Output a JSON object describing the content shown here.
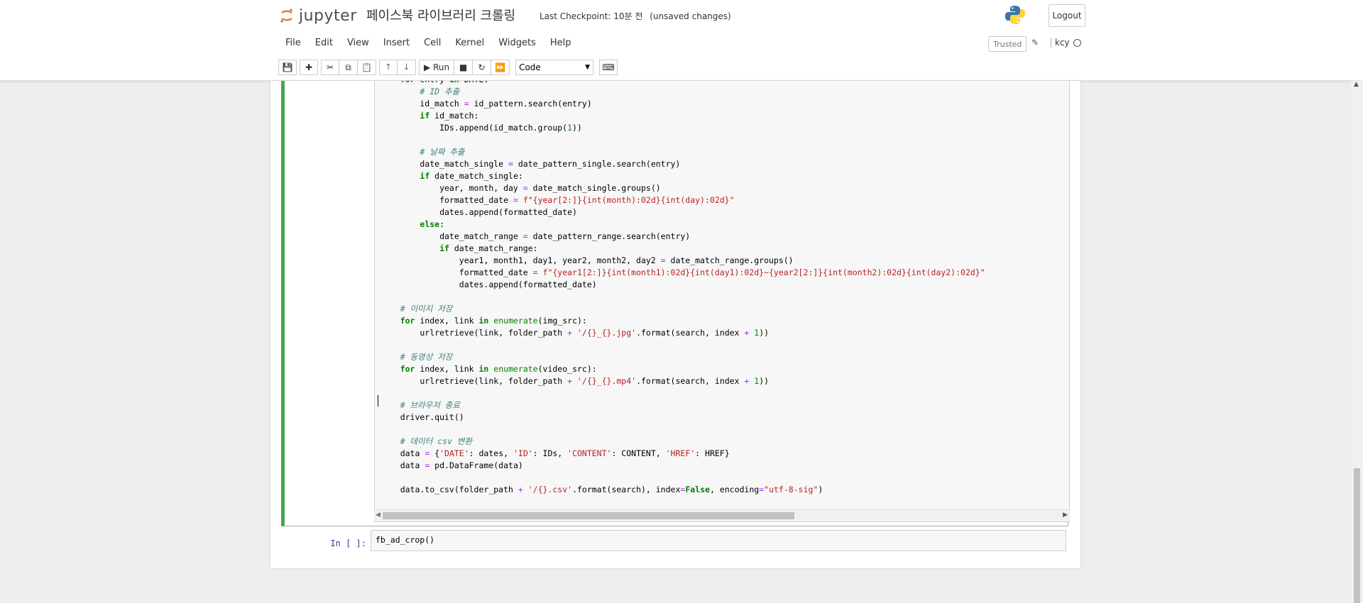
{
  "header": {
    "logo_text": "jupyter",
    "notebook_title": "페이스북 라이브러리 크롤링",
    "checkpoint_label": "Last Checkpoint:",
    "checkpoint_time": "10분 전",
    "save_status": "(unsaved changes)",
    "logout_label": "Logout"
  },
  "menu": {
    "items": [
      "File",
      "Edit",
      "View",
      "Insert",
      "Cell",
      "Kernel",
      "Widgets",
      "Help"
    ],
    "trusted_label": "Trusted",
    "kernel_name": "kcy"
  },
  "toolbar": {
    "run_label": "Run",
    "cell_type": "Code"
  },
  "cells": [
    {
      "prompt": "",
      "code_lines": [
        "    for entry in DATE:",
        "        # ID 추출",
        "        id_match = id_pattern.search(entry)",
        "        if id_match:",
        "            IDs.append(id_match.group(1))",
        "",
        "        # 날짜 추출",
        "        date_match_single = date_pattern_single.search(entry)",
        "        if date_match_single:",
        "            year, month, day = date_match_single.groups()",
        "            formatted_date = f\"{year[2:]}{int(month):02d}{int(day):02d}\"",
        "            dates.append(formatted_date)",
        "        else:",
        "            date_match_range = date_pattern_range.search(entry)",
        "            if date_match_range:",
        "                year1, month1, day1, year2, month2, day2 = date_match_range.groups()",
        "                formatted_date = f\"{year1[2:]}{int(month1):02d}{int(day1):02d}~{year2[2:]}{int(month2):02d}{int(day2):02d}\"",
        "                dates.append(formatted_date)",
        "",
        "    # 이미지 저장",
        "    for index, link in enumerate(img_src):",
        "        urlretrieve(link, folder_path + '/{}_{}.jpg'.format(search, index + 1))",
        "",
        "    # 동영상 저장",
        "    for index, link in enumerate(video_src):",
        "        urlretrieve(link, folder_path + '/{}_{}.mp4'.format(search, index + 1))",
        "",
        "    # 브라우저 종료",
        "    driver.quit()",
        "",
        "    # 데이터 csv 변환",
        "    data = {'DATE': dates, 'ID': IDs, 'CONTENT': CONTENT, 'HREF': HREF}",
        "    data = pd.DataFrame(data)",
        "",
        "    data.to_csv(folder_path + '/{}.csv'.format(search), index=False, encoding=\"utf-8-sig\")"
      ]
    },
    {
      "prompt": "In [ ]:",
      "code": "fb_ad_crop()"
    }
  ],
  "colors": {
    "selected_cell_border": "#42a94b",
    "prompt_color": "#303f9f",
    "keyword": "#008000",
    "string": "#ba2121",
    "comment": "#408080"
  }
}
